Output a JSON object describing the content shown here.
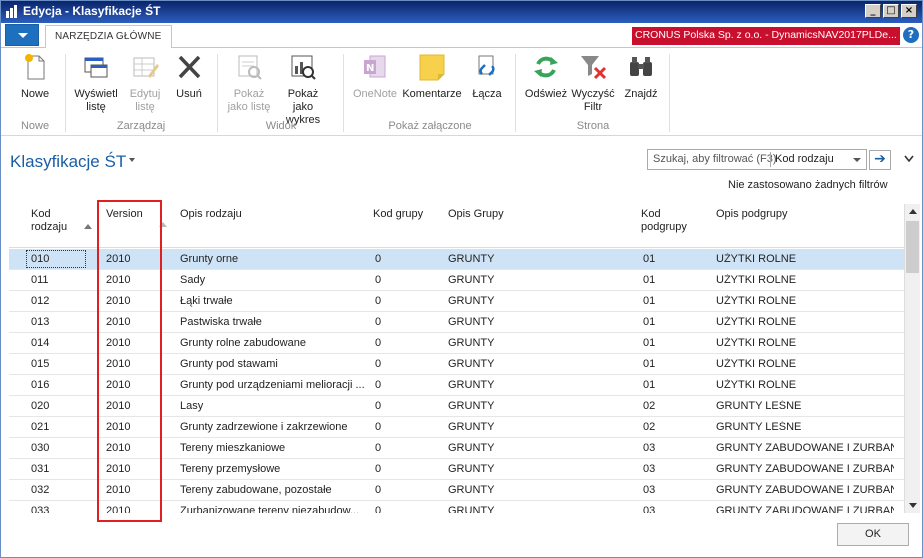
{
  "window": {
    "title": "Edycja - Klasyfikacje ŚT"
  },
  "ribbon": {
    "tab_home": "NARZĘDZIA GŁÓWNE",
    "company": "CRONUS Polska Sp. z o.o. - DynamicsNAV2017PLDe...",
    "help": "?",
    "groups": {
      "nowe": "Nowe",
      "zarzadzaj": "Zarządzaj",
      "widok": "Widok",
      "zalaczone": "Pokaż załączone",
      "strona": "Strona"
    },
    "buttons": {
      "nowe": [
        "Nowe",
        ""
      ],
      "wyswietl": [
        "Wyświetl",
        "listę"
      ],
      "edytuj": [
        "Edytuj",
        "listę"
      ],
      "usun": [
        "Usuń",
        ""
      ],
      "pokaz_liste": [
        "Pokaż",
        "jako listę"
      ],
      "pokaz_wykres": [
        "Pokaż jako",
        "wykres"
      ],
      "onenote": [
        "OneNote",
        ""
      ],
      "komentarze": [
        "Komentarze",
        ""
      ],
      "lacza": [
        "Łącza",
        ""
      ],
      "odswiez": [
        "Odśwież",
        ""
      ],
      "wyczysc": [
        "Wyczyść",
        "Filtr"
      ],
      "znajdz": [
        "Znajdź",
        ""
      ]
    }
  },
  "page": {
    "title": "Klasyfikacje ŚT",
    "filter_placeholder": "Szukaj, aby filtrować (F3)",
    "filter_field": "Kod rodzaju",
    "no_filters": "Nie zastosowano żadnych filtrów",
    "ok": "OK"
  },
  "table": {
    "headers": {
      "kod_rodzaju": [
        "Kod",
        "rodzaju"
      ],
      "version": "Version",
      "opis_rodzaju": "Opis rodzaju",
      "kod_grupy": "Kod grupy",
      "opis_grupy": "Opis Grupy",
      "kod_podgrupy": [
        "Kod",
        "podgrupy"
      ],
      "opis_podgrupy": "Opis podgrupy"
    },
    "rows": [
      [
        "010",
        "2010",
        "Grunty orne",
        "0",
        "GRUNTY",
        "01",
        "UŻYTKI ROLNE"
      ],
      [
        "011",
        "2010",
        "Sady",
        "0",
        "GRUNTY",
        "01",
        "UŻYTKI ROLNE"
      ],
      [
        "012",
        "2010",
        "Łąki trwałe",
        "0",
        "GRUNTY",
        "01",
        "UŻYTKI ROLNE"
      ],
      [
        "013",
        "2010",
        "Pastwiska trwałe",
        "0",
        "GRUNTY",
        "01",
        "UŻYTKI ROLNE"
      ],
      [
        "014",
        "2010",
        "Grunty rolne zabudowane",
        "0",
        "GRUNTY",
        "01",
        "UŻYTKI ROLNE"
      ],
      [
        "015",
        "2010",
        "Grunty pod stawami",
        "0",
        "GRUNTY",
        "01",
        "UŻYTKI ROLNE"
      ],
      [
        "016",
        "2010",
        "Grunty pod urządzeniami melioracji ...",
        "0",
        "GRUNTY",
        "01",
        "UŻYTKI ROLNE"
      ],
      [
        "020",
        "2010",
        "Lasy",
        "0",
        "GRUNTY",
        "02",
        "GRUNTY LEŚNE"
      ],
      [
        "021",
        "2010",
        "Grunty zadrzewione i zakrzewione",
        "0",
        "GRUNTY",
        "02",
        "GRUNTY LEŚNE"
      ],
      [
        "030",
        "2010",
        "Tereny mieszkaniowe",
        "0",
        "GRUNTY",
        "03",
        "GRUNTY ZABUDOWANE I ZURBANI..."
      ],
      [
        "031",
        "2010",
        "Tereny przemysłowe",
        "0",
        "GRUNTY",
        "03",
        "GRUNTY ZABUDOWANE I ZURBANI..."
      ],
      [
        "032",
        "2010",
        "Tereny zabudowane, pozostałe",
        "0",
        "GRUNTY",
        "03",
        "GRUNTY ZABUDOWANE I ZURBANI..."
      ],
      [
        "033",
        "2010",
        "Zurbanizowane tereny niezabudow...",
        "0",
        "GRUNTY",
        "03",
        "GRUNTY ZABUDOWANE I ZURBANI..."
      ]
    ]
  }
}
